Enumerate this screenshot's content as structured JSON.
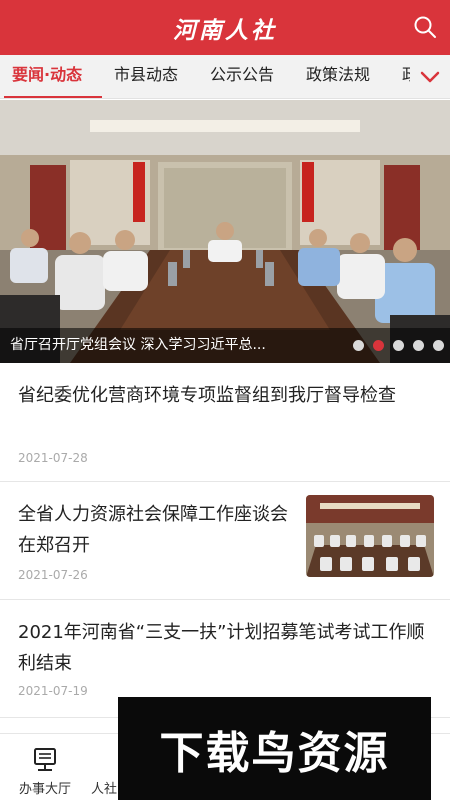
{
  "header": {
    "title": "河南人社",
    "search_icon": "search-icon"
  },
  "tabs": [
    {
      "label": "要闻·动态",
      "active": true
    },
    {
      "label": "市县动态",
      "active": false
    },
    {
      "label": "公示公告",
      "active": false
    },
    {
      "label": "政策法规",
      "active": false
    },
    {
      "label": "政",
      "active": false
    }
  ],
  "tabs_more_icon": "chevron-down-icon",
  "banner": {
    "caption": "省厅召开厅党组会议 深入学习习近平总...",
    "slide_count": 5,
    "active_slide": 2
  },
  "news": [
    {
      "title": "省纪委优化营商环境专项监督组到我厅督导检查",
      "date": "2021-07-28"
    },
    {
      "title": "全省人力资源社会保障工作座谈会在郑召开",
      "date": "2021-07-26"
    },
    {
      "title": "2021年河南省“三支一扶”计划招募笔试考试工作顺利结束",
      "date": "2021-07-19"
    }
  ],
  "bottom_nav": [
    {
      "label": "办事大厅",
      "icon": "service-hall-icon"
    },
    {
      "label": "人社",
      "icon": "news-icon"
    }
  ],
  "watermark": "下载鸟资源",
  "colors": {
    "brand": "#d9343b"
  }
}
